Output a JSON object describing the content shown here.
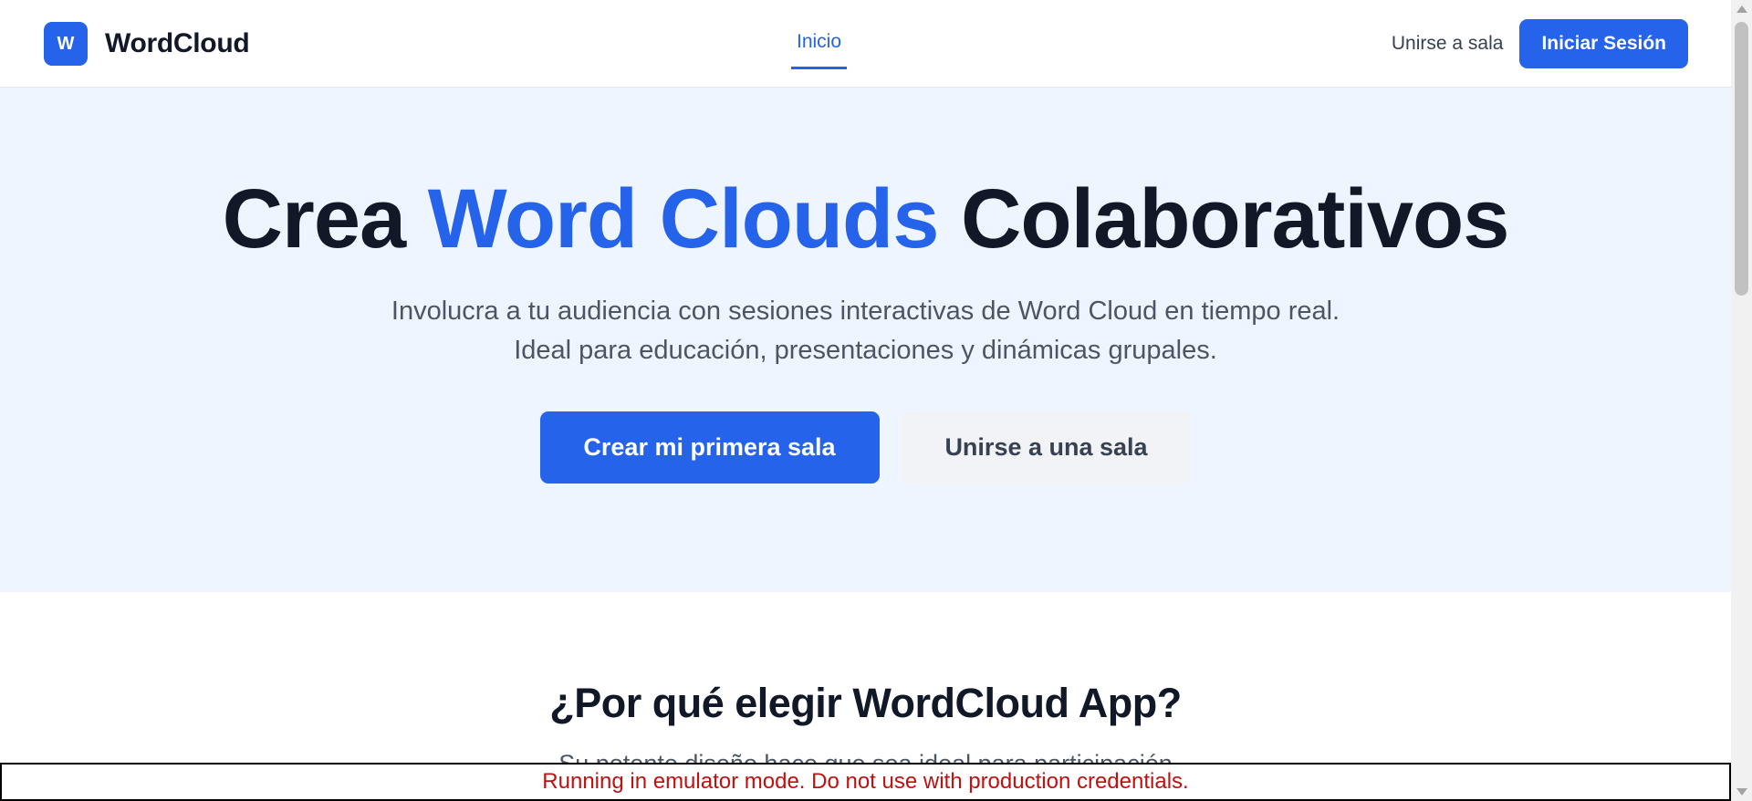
{
  "navbar": {
    "logo_letter": "W",
    "brand_name": "WordCloud",
    "nav_active": "Inicio",
    "join_link": "Unirse a sala",
    "login_button": "Iniciar Sesión"
  },
  "hero": {
    "title_part1": "Crea ",
    "title_accent": "Word Clouds",
    "title_part2": " Colaborativos",
    "subtitle_line1": "Involucra a tu audiencia con sesiones interactivas de Word Cloud en tiempo real.",
    "subtitle_line2": "Ideal para educación, presentaciones y dinámicas grupales.",
    "primary_button": "Crear mi primera sala",
    "secondary_button": "Unirse a una sala"
  },
  "features": {
    "title": "¿Por qué elegir WordCloud App?",
    "subtitle": "Su potente diseño hace que sea ideal para participación"
  },
  "banner": {
    "text": "Running in emulator mode. Do not use with production credentials."
  },
  "colors": {
    "accent": "#2563eb",
    "hero_bg": "#eff5fe",
    "banner_text": "#c01010"
  }
}
